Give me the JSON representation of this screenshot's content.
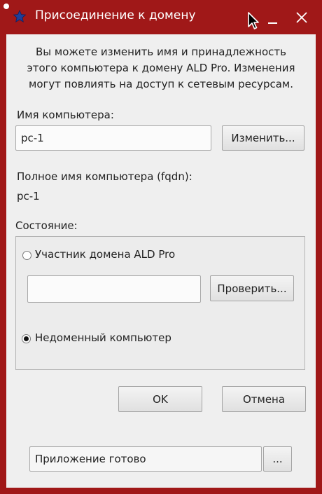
{
  "window": {
    "title": "Присоединение к домену",
    "colors": {
      "frame": "#a01818",
      "client": "#efefef"
    },
    "icons": {
      "app": "star-icon",
      "minimize": "minimize-icon",
      "close": "close-icon",
      "cursor": "mouse-pointer-icon"
    }
  },
  "intro_text": "Вы можете изменить имя и принадлежность\nэтого компьютера к домену ALD Pro. Изменения\nмогут повлиять на доступ к сетевым ресурсам.",
  "computer_name": {
    "label": "Имя компьютера:",
    "value": "pc-1",
    "change_button": "Изменить..."
  },
  "fqdn": {
    "label": "Полное имя компьютера (fqdn):",
    "value": "pc-1"
  },
  "status": {
    "label": "Состояние:",
    "domain_member_option": "Участник домена ALD Pro",
    "domain_member_checked": false,
    "domain_value": "",
    "check_button": "Проверить...",
    "non_domain_option": "Недоменный компьютер",
    "non_domain_checked": true
  },
  "buttons": {
    "ok": "OK",
    "cancel": "Отмена"
  },
  "statusbar": {
    "text": "Приложение готово",
    "more_button": "..."
  }
}
